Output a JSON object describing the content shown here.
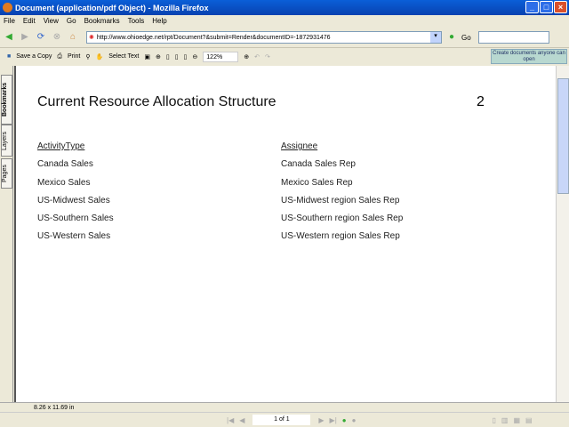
{
  "window": {
    "title": "Document (application/pdf Object) - Mozilla Firefox"
  },
  "menu": [
    "File",
    "Edit",
    "View",
    "Go",
    "Bookmarks",
    "Tools",
    "Help"
  ],
  "nav": {
    "url": "http://www.ohioedge.net/rpt/Document?&submit=Render&documentID=-1872931476",
    "go": "Go"
  },
  "acrobat": {
    "save": "Save a Copy",
    "print": "Print",
    "select_text": "Select Text",
    "zoom": "122%",
    "promo": "Create documents anyone can open"
  },
  "sidetabs": [
    "Bookmarks",
    "Layers",
    "Pages"
  ],
  "document": {
    "title": "Current Resource Allocation Structure",
    "page_number": "2",
    "headers": [
      "ActivityType",
      "Assignee"
    ],
    "rows": [
      [
        "Canada Sales",
        "Canada Sales Rep"
      ],
      [
        "Mexico Sales",
        "Mexico Sales Rep"
      ],
      [
        "US-Midwest Sales",
        "US-Midwest region Sales Rep"
      ],
      [
        "US-Southern Sales",
        "US-Southern region Sales Rep"
      ],
      [
        "US-Western Sales",
        "US-Western region Sales Rep"
      ]
    ]
  },
  "status": {
    "page_size": "8.26 x 11.69 in",
    "page_indicator": "1 of 1"
  }
}
